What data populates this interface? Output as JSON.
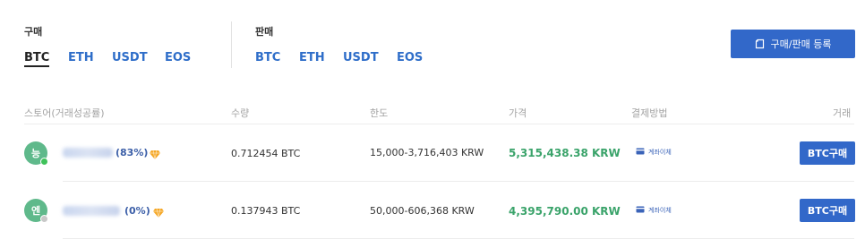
{
  "buy": {
    "label": "구매",
    "coins": [
      "BTC",
      "ETH",
      "USDT",
      "EOS"
    ],
    "active": "BTC"
  },
  "sell": {
    "label": "판매",
    "coins": [
      "BTC",
      "ETH",
      "USDT",
      "EOS"
    ]
  },
  "register_button": {
    "label": "구매/판매 등록",
    "icon": "register-icon"
  },
  "table": {
    "headers": {
      "store": "스토어(거래성공률)",
      "quantity": "수량",
      "limit": "한도",
      "price": "가격",
      "payment": "결제방법",
      "trade": "거래"
    },
    "rows": [
      {
        "avatar_letter": "능",
        "avatar_color": "#5fb98b",
        "online": true,
        "success_rate": "(83%)",
        "quantity": "0.712454 BTC",
        "limit": "15,000-3,716,403 KRW",
        "price": "5,315,438.38 KRW",
        "payment": "계좌이체",
        "trade_button": "BTC구매"
      },
      {
        "avatar_letter": "엔",
        "avatar_color": "#5fb98b",
        "online": false,
        "success_rate": "(0%)",
        "quantity": "0.137943 BTC",
        "limit": "50,000-606,368 KRW",
        "price": "4,395,790.00 KRW",
        "payment": "계좌이체",
        "trade_button": "BTC구매"
      }
    ]
  },
  "colors": {
    "accent": "#3268c9",
    "price_green": "#3aa36a",
    "avatar_green": "#5fb98b",
    "online_dot": "#3fc25a",
    "offline_dot": "#c8c8c8",
    "diamond": "#f5a623"
  }
}
